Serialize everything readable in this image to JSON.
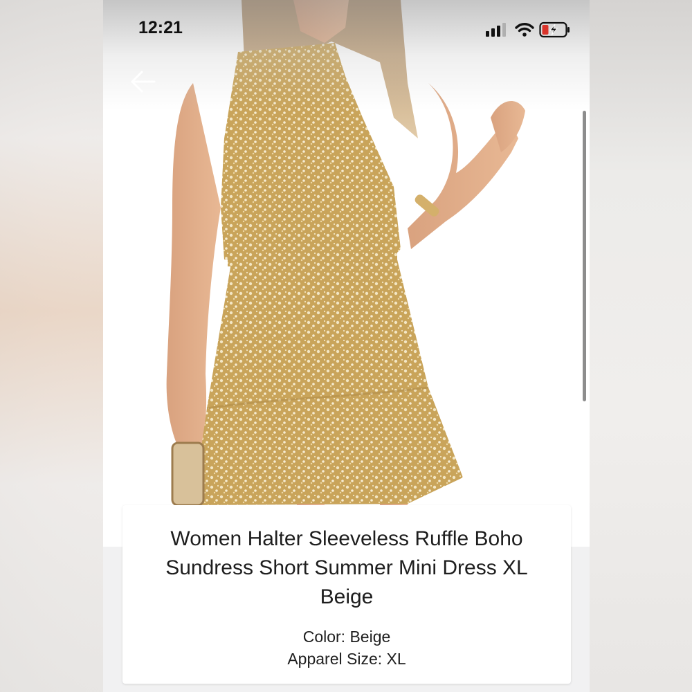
{
  "status_bar": {
    "time": "12:21",
    "icons": [
      "cellular-signal-icon",
      "wifi-icon",
      "battery-charging-icon"
    ]
  },
  "navigation": {
    "back_icon": "arrow-left-icon"
  },
  "product_image": {
    "subject": "product-photo"
  },
  "product": {
    "title": "Women Halter Sleeveless Ruffle Boho Sundress Short Summer Mini Dress XL Beige",
    "color_line": "Color: Beige",
    "size_line": "Apparel Size: XL"
  },
  "colors": {
    "dress": "#c9a45a",
    "battery_accent": "#d9342b"
  }
}
